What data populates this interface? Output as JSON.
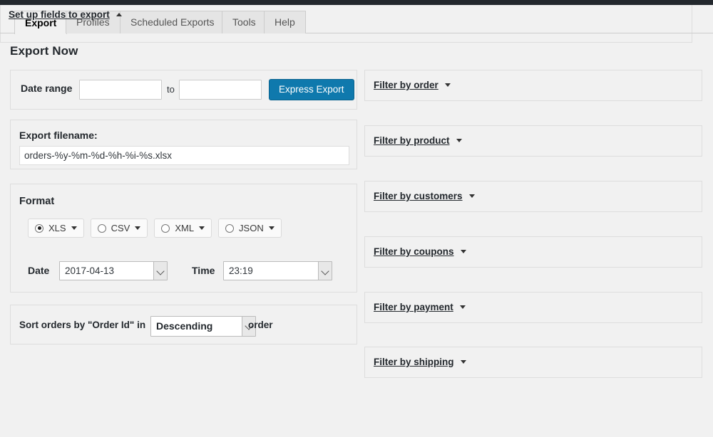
{
  "app": {
    "page_title": "Export Now"
  },
  "tabs": [
    {
      "label": "Export",
      "active": true
    },
    {
      "label": "Profiles",
      "active": false
    },
    {
      "label": "Scheduled Exports",
      "active": false
    },
    {
      "label": "Tools",
      "active": false
    },
    {
      "label": "Help",
      "active": false
    }
  ],
  "date_range": {
    "label": "Date range",
    "from_value": "",
    "from_placeholder": "",
    "to_text": "to",
    "to_value": "",
    "to_placeholder": "",
    "button_label": "Express Export",
    "button_color": "#0f79ad"
  },
  "filename": {
    "label": "Export filename:",
    "value": "orders-%y-%m-%d-%h-%i-%s.xlsx",
    "placeholder": ""
  },
  "format": {
    "title": "Format",
    "options": [
      {
        "label": "XLS",
        "selected": true
      },
      {
        "label": "CSV",
        "selected": false
      },
      {
        "label": "XML",
        "selected": false
      },
      {
        "label": "JSON",
        "selected": false
      }
    ],
    "date_label": "Date",
    "date_value": "2017-04-13",
    "time_label": "Time",
    "time_value": "23:19"
  },
  "sort": {
    "prefix": "Sort orders by \"Order Id\" in",
    "value": "Descending",
    "suffix": "order"
  },
  "filters": [
    {
      "label": "Filter by order",
      "icon": "caret-down-icon",
      "expanded": false
    },
    {
      "label": "Filter by product",
      "icon": "caret-down-icon",
      "expanded": false
    },
    {
      "label": "Filter by customers",
      "icon": "caret-down-icon",
      "expanded": false
    },
    {
      "label": "Filter by coupons",
      "icon": "caret-down-icon",
      "expanded": false
    },
    {
      "label": "Filter by payment",
      "icon": "caret-down-icon",
      "expanded": false
    },
    {
      "label": "Filter by shipping",
      "icon": "caret-down-icon",
      "expanded": false
    }
  ],
  "fields_section": {
    "label": "Set up fields to export",
    "icon": "caret-up-icon",
    "expanded": true
  }
}
